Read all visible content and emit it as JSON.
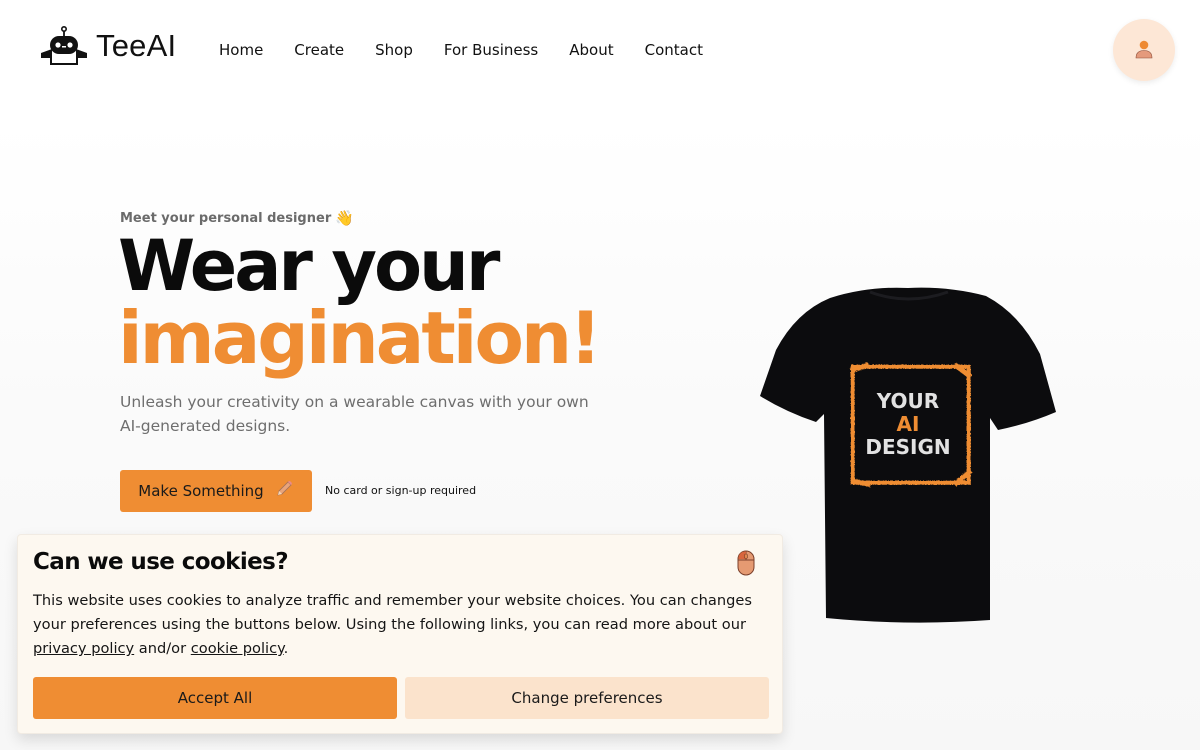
{
  "brand": {
    "name": "TeeAI",
    "accent": "#ef8d33"
  },
  "nav": {
    "items": [
      {
        "label": "Home"
      },
      {
        "label": "Create"
      },
      {
        "label": "Shop"
      },
      {
        "label": "For Business"
      },
      {
        "label": "About"
      },
      {
        "label": "Contact"
      }
    ],
    "account_icon": "user-icon"
  },
  "hero": {
    "eyebrow": "Meet your personal designer",
    "eyebrow_emoji": "👋",
    "title_line1": "Wear your",
    "title_line2": "imagination!",
    "subtitle": "Unleash your creativity on a wearable canvas with your own AI-generated designs.",
    "cta_label": "Make Something",
    "cta_icon": "pencil-icon",
    "cta_note": "No card or sign-up required",
    "tshirt_text": {
      "line1": "YOUR",
      "line2": "AI",
      "line3": "DESIGN"
    }
  },
  "cookie": {
    "title": "Can we use cookies?",
    "icon": "mouse-icon",
    "text_before": "This website uses cookies to analyze traffic and remember your website choices. You can changes your preferences using the buttons below. Using the following links, you can read more about our ",
    "privacy_link": "privacy policy",
    "text_middle": " and/or ",
    "cookie_link": "cookie policy",
    "text_after": ".",
    "accept_label": "Accept All",
    "prefs_label": "Change preferences"
  }
}
